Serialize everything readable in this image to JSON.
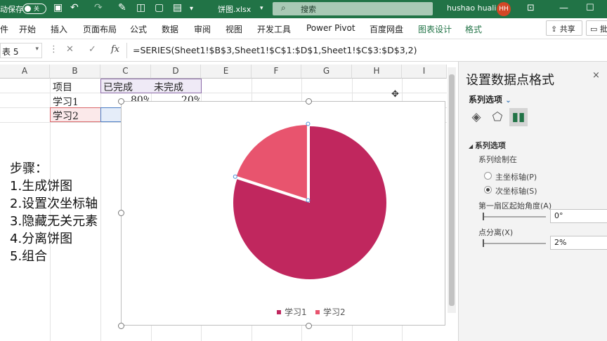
{
  "titlebar": {
    "autosave_label": "动保存",
    "toggle_label": "关",
    "filename": "饼图.xlsx",
    "filename_caret": "▾",
    "search_placeholder": "搜索",
    "user_name": "hushao huali",
    "avatar_initials": "HH",
    "bg_color": "#217346"
  },
  "ribbon": {
    "tabs": [
      "件",
      "开始",
      "插入",
      "页面布局",
      "公式",
      "数据",
      "审阅",
      "视图",
      "开发工具",
      "Power Pivot",
      "百度网盘"
    ],
    "context_tabs": [
      "图表设计",
      "格式"
    ],
    "share_label": "共享",
    "comment_label": "批"
  },
  "formula_bar": {
    "name_box": "表 5",
    "fx_label": "fx",
    "formula": "=SERIES(Sheet1!$B$3,Sheet1!$C$1:$D$1,Sheet1!$C$3:$D$3,2)"
  },
  "columns": [
    "A",
    "B",
    "C",
    "D",
    "E",
    "F",
    "G",
    "H",
    "I"
  ],
  "cells": {
    "b1": "项目",
    "c1": "已完成",
    "d1": "未完成",
    "b2": "学习1",
    "c2": "80%",
    "d2": "20%",
    "b3": "学习2"
  },
  "steps": [
    "步骤：",
    "1.生成饼图",
    "2.设置次坐标轴",
    "3.隐藏无关元素",
    "4.分离饼图",
    "5.组合"
  ],
  "chart_data": {
    "type": "pie",
    "series": [
      {
        "name": "学习1",
        "values": [
          80,
          20
        ]
      },
      {
        "name": "学习2",
        "values": [
          80,
          20
        ]
      }
    ],
    "categories": [
      "已完成",
      "未完成"
    ],
    "legend": [
      "学习1",
      "学习2"
    ],
    "legend_position": "bottom",
    "colors": {
      "series1": "#c0275e",
      "series2": "#e8546e"
    }
  },
  "format_pane": {
    "title": "设置数据点格式",
    "close": "×",
    "options_dropdown": "系列选项",
    "section": "系列选项",
    "plot_on_label": "系列绘制在",
    "primary_axis": "主坐标轴(P)",
    "secondary_axis": "次坐标轴(S)",
    "first_slice_angle_label": "第一扇区起始角度(A)",
    "first_slice_angle_value": "0°",
    "explosion_label": "点分离(X)",
    "explosion_value": "2%",
    "first_slice_angle": 0,
    "explosion_percent": 2
  }
}
